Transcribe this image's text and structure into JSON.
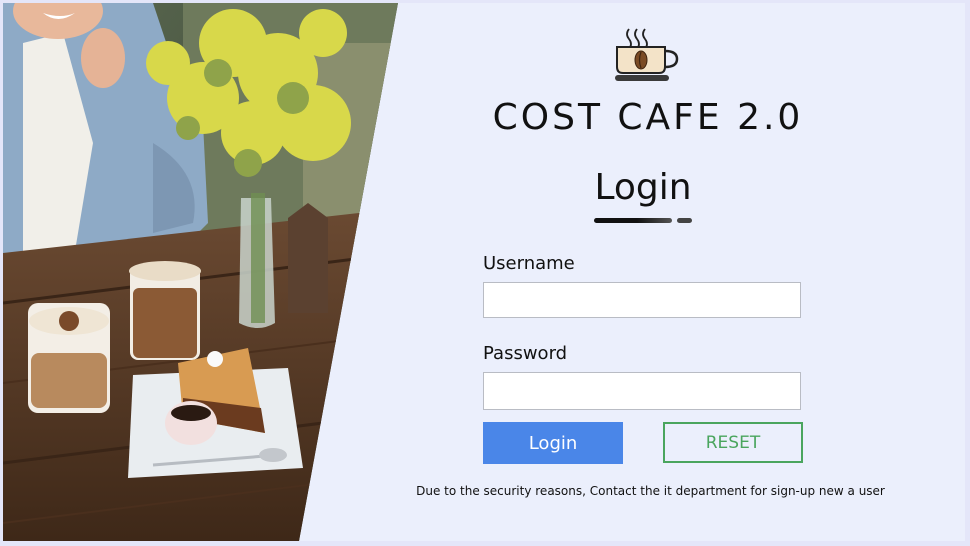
{
  "brand": {
    "title": "COST CAFE 2.0",
    "icon": "coffee-cup-icon"
  },
  "login": {
    "heading": "Login",
    "username_label": "Username",
    "username_value": "",
    "password_label": "Password",
    "password_value": "",
    "login_button": "Login",
    "reset_button": "RESET",
    "notice": "Due to the security reasons, Contact the it department for sign-up new a user"
  },
  "colors": {
    "background": "#ebeffc",
    "login_button": "#4a86e8",
    "reset_button": "#4aa55e"
  }
}
